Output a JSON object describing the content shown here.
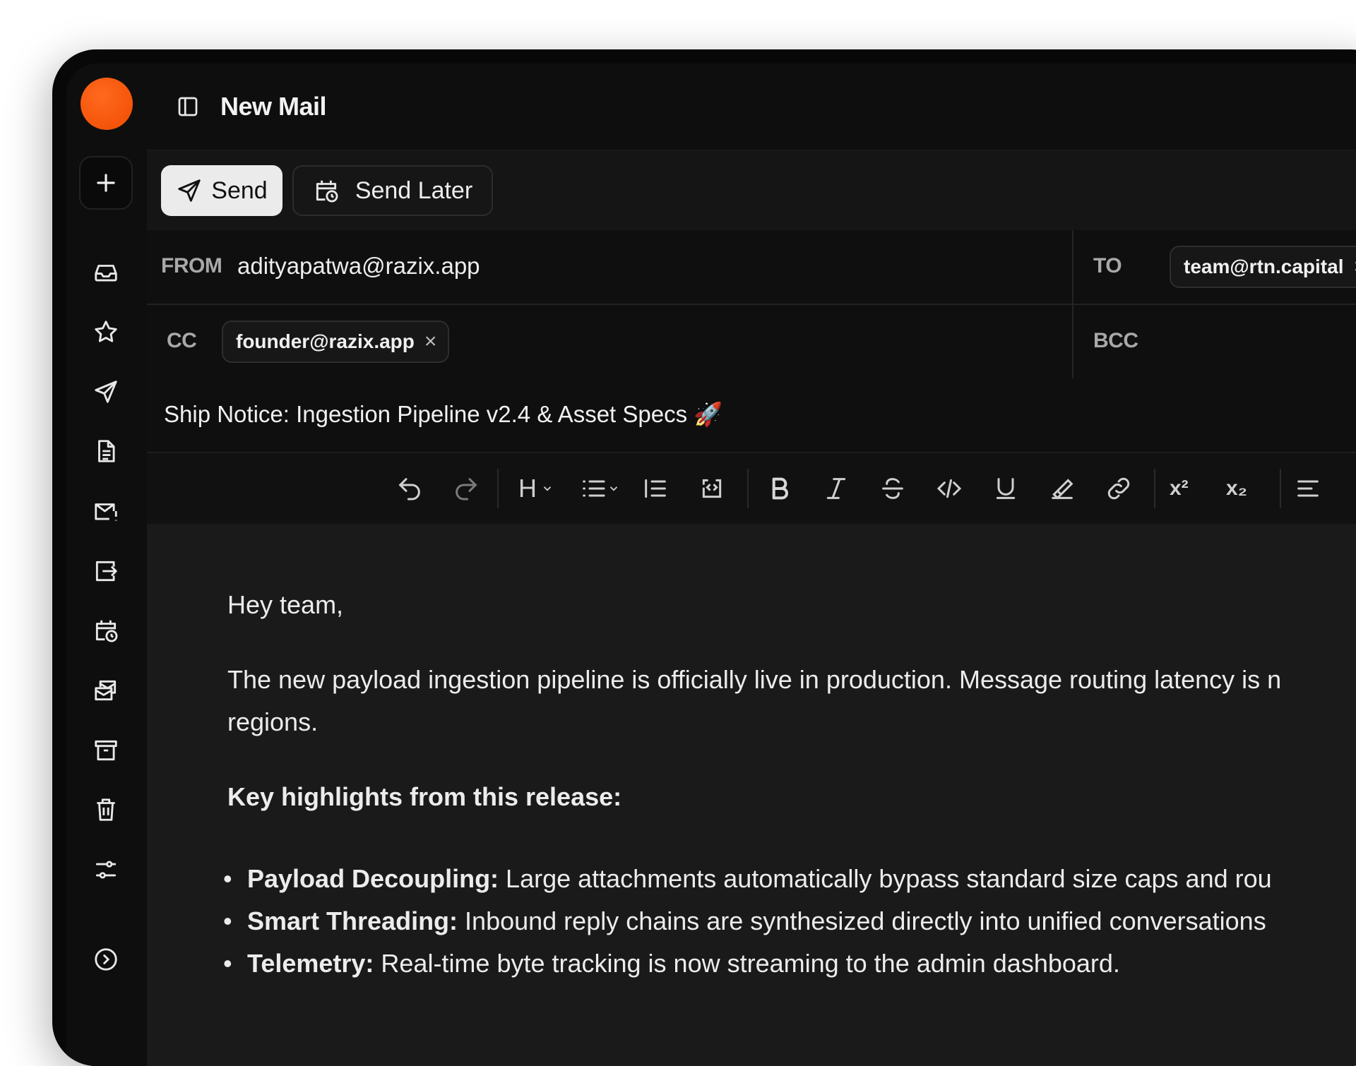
{
  "window": {
    "title": "New Mail"
  },
  "sidebar": {
    "items": [
      {
        "icon": "inbox-icon"
      },
      {
        "icon": "star-icon"
      },
      {
        "icon": "sent-icon"
      },
      {
        "icon": "drafts-icon"
      },
      {
        "icon": "important-mail-icon"
      },
      {
        "icon": "outbox-icon"
      },
      {
        "icon": "scheduled-icon"
      },
      {
        "icon": "all-mail-icon"
      },
      {
        "icon": "archive-icon"
      },
      {
        "icon": "trash-icon"
      },
      {
        "icon": "settings-sliders-icon"
      },
      {
        "icon": "expand-icon"
      }
    ]
  },
  "actions": {
    "send_label": "Send",
    "send_later_label": "Send Later"
  },
  "fields": {
    "from_label": "FROM",
    "from_value": "adityapatwa@razix.app",
    "to_label": "TO",
    "to_chips": [
      "team@rtn.capital"
    ],
    "cc_label": "CC",
    "cc_chips": [
      "founder@razix.app"
    ],
    "bcc_label": "BCC",
    "subject": "Ship Notice: Ingestion Pipeline v2.4 & Asset Specs 🚀",
    "chip_remove": "×"
  },
  "toolbar": {
    "heading_label": "H",
    "superscript_label": "x²",
    "subscript_label": "x₂"
  },
  "body": {
    "greeting": "Hey team,",
    "paragraph_line1": "The new payload ingestion pipeline is officially live in production. Message routing latency is n",
    "paragraph_line2": "regions.",
    "highlights_heading": "Key highlights from this release:",
    "bullets": [
      {
        "bold": "Payload Decoupling:",
        "text": " Large attachments automatically bypass standard size caps and rou"
      },
      {
        "bold": "Smart Threading:",
        "text": " Inbound reply chains are synthesized directly into unified conversations"
      },
      {
        "bold": "Telemetry:",
        "text": " Real-time byte tracking is now streaming to the admin dashboard."
      }
    ]
  },
  "colors": {
    "accent": "#ff5a0a",
    "send_bg": "#ebebeb",
    "background": "#1a1a1a"
  }
}
